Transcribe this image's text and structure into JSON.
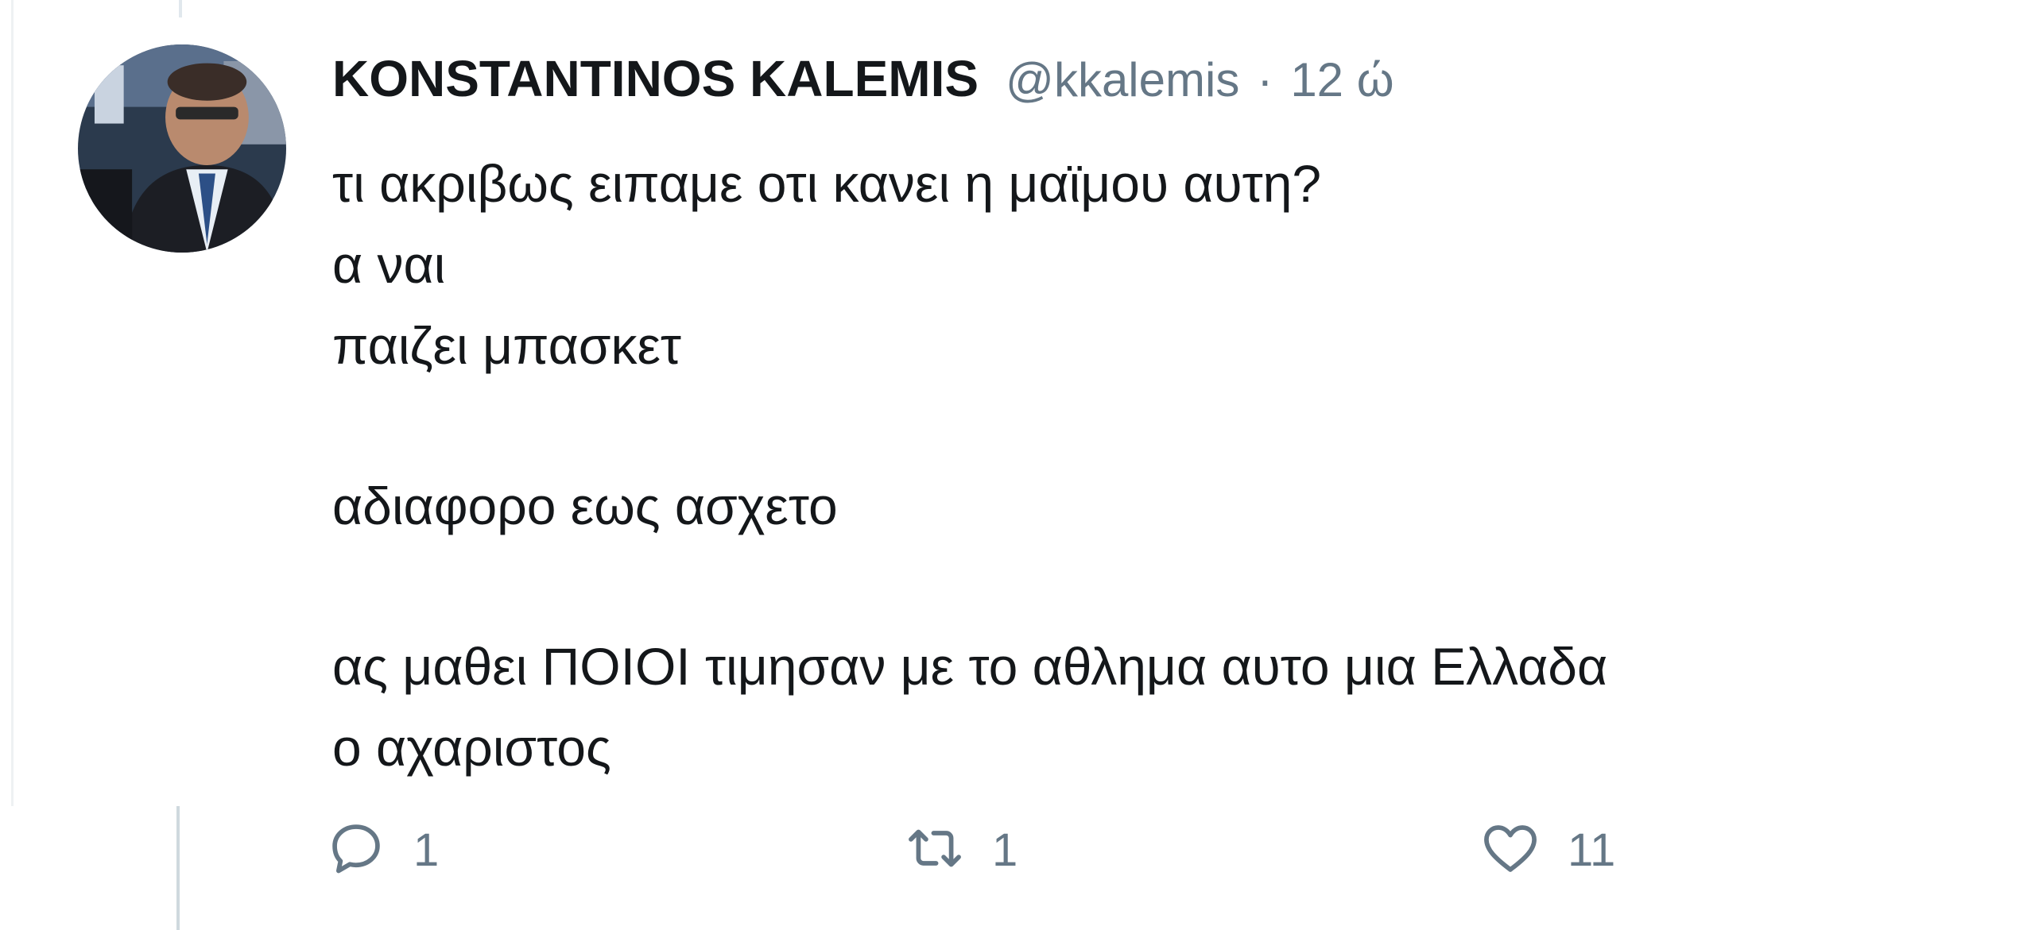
{
  "tweet": {
    "author_name": "KONSTANTINOS KALEMIS",
    "handle": "@kkalemis",
    "separator": "·",
    "time": "12 ώ",
    "lines": [
      "τι ακριβως ειπαμε οτι κανει η μαϊμου αυτη?",
      "α ναι",
      "παιζει μπασκετ",
      "",
      "αδιαφορο εως ασχετο",
      "",
      "ας μαθει ΠΟΙΟΙ τιμησαν με το αθλημα αυτο μια Ελλαδα",
      "ο αχαριστος"
    ],
    "actions": {
      "reply": {
        "icon": "reply-icon",
        "count": "1"
      },
      "retweet": {
        "icon": "retweet-icon",
        "count": "1"
      },
      "like": {
        "icon": "heart-icon",
        "count": "11"
      }
    }
  },
  "colors": {
    "text": "#14171a",
    "secondary": "#657786",
    "thread_line": "#cfd9de"
  }
}
